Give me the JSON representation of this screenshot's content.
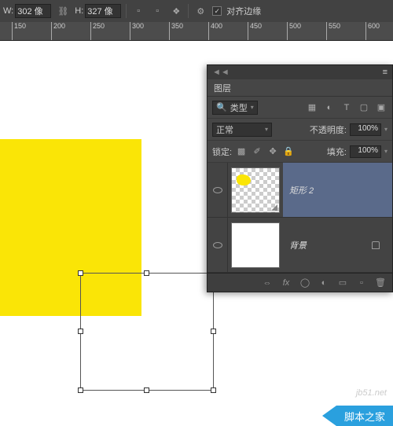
{
  "toolbar": {
    "w_label": "W:",
    "w_value": "302 像",
    "h_label": "H:",
    "h_value": "327 像",
    "align_edges": "对齐边缘"
  },
  "ruler": {
    "ticks": [
      "150",
      "200",
      "250",
      "300",
      "350",
      "400",
      "450",
      "500",
      "550",
      "600"
    ]
  },
  "panel": {
    "title": "图层",
    "filter_label": "类型",
    "blend_mode": "正常",
    "opacity_label": "不透明度:",
    "opacity_value": "100%",
    "lock_label": "锁定:",
    "fill_label": "填充:",
    "fill_value": "100%",
    "layers": [
      {
        "name": "矩形 2",
        "locked": false,
        "selected": true
      },
      {
        "name": "背景",
        "locked": true,
        "selected": false
      }
    ],
    "footer_fx": "fx"
  },
  "watermark": "jb51.net",
  "banner": "脚本之家"
}
